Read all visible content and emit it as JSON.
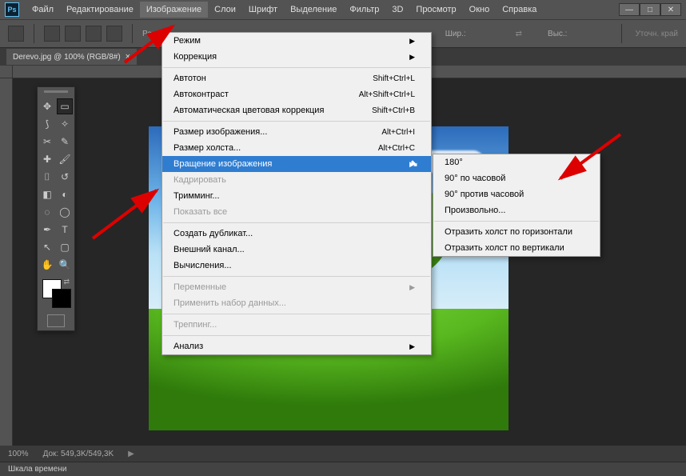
{
  "app": {
    "logo": "Ps"
  },
  "menubar": {
    "items": [
      "Файл",
      "Редактирование",
      "Изображение",
      "Слои",
      "Шрифт",
      "Выделение",
      "Фильтр",
      "3D",
      "Просмотр",
      "Окно",
      "Справка"
    ],
    "active_index": 2
  },
  "window_controls": {
    "min": "—",
    "max": "□",
    "close": "✕"
  },
  "options_bar": {
    "pa_label": "Ра",
    "width_label": "Шир.:",
    "height_label": "Выс.:",
    "refine_label": "Уточн. край"
  },
  "tab": {
    "title": "Derevo.jpg @ 100% (RGB/8#)",
    "close": "×"
  },
  "toolbox": {
    "tools": [
      "move",
      "marquee",
      "lasso",
      "wand",
      "crop",
      "eyedropper",
      "heal",
      "brush",
      "stamp",
      "history",
      "eraser",
      "gradient",
      "blur",
      "dodge",
      "pen",
      "type",
      "path",
      "shape",
      "hand",
      "zoom"
    ]
  },
  "image_menu": {
    "groups": [
      [
        {
          "label": "Режим",
          "sub": true
        },
        {
          "label": "Коррекция",
          "sub": true
        }
      ],
      [
        {
          "label": "Автотон",
          "shortcut": "Shift+Ctrl+L"
        },
        {
          "label": "Автоконтраст",
          "shortcut": "Alt+Shift+Ctrl+L"
        },
        {
          "label": "Автоматическая цветовая коррекция",
          "shortcut": "Shift+Ctrl+B"
        }
      ],
      [
        {
          "label": "Размер изображения...",
          "shortcut": "Alt+Ctrl+I"
        },
        {
          "label": "Размер холста...",
          "shortcut": "Alt+Ctrl+C"
        },
        {
          "label": "Вращение изображения",
          "sub": true,
          "highlighted": true
        },
        {
          "label": "Кадрировать",
          "disabled": true
        },
        {
          "label": "Тримминг..."
        },
        {
          "label": "Показать все",
          "disabled": true
        }
      ],
      [
        {
          "label": "Создать дубликат..."
        },
        {
          "label": "Внешний канал..."
        },
        {
          "label": "Вычисления..."
        }
      ],
      [
        {
          "label": "Переменные",
          "sub": true,
          "disabled": true
        },
        {
          "label": "Применить набор данных...",
          "disabled": true
        }
      ],
      [
        {
          "label": "Треппинг...",
          "disabled": true
        }
      ],
      [
        {
          "label": "Анализ",
          "sub": true
        }
      ]
    ]
  },
  "rotation_submenu": {
    "groups": [
      [
        {
          "label": "180°"
        },
        {
          "label": "90° по часовой"
        },
        {
          "label": "90° против часовой"
        },
        {
          "label": "Произвольно..."
        }
      ],
      [
        {
          "label": "Отразить холст по горизонтали"
        },
        {
          "label": "Отразить холст по вертикали"
        }
      ]
    ]
  },
  "status": {
    "zoom": "100%",
    "doc": "Док: 549,3K/549,3K"
  },
  "timeline": {
    "label": "Шкала времени"
  }
}
